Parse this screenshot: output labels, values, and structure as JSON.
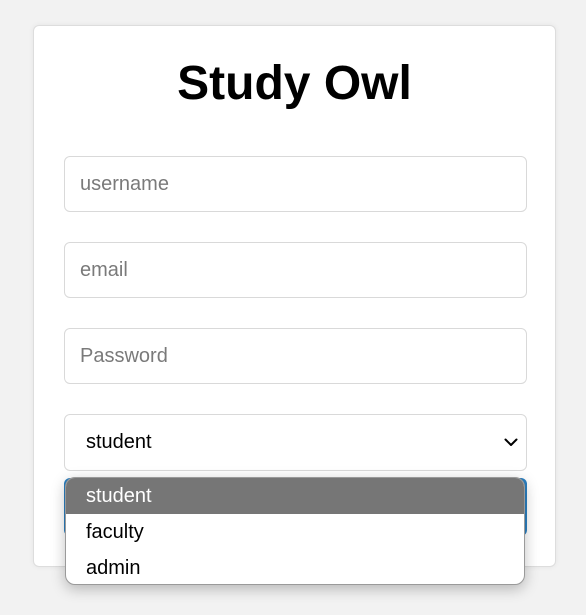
{
  "app": {
    "title": "Study Owl"
  },
  "form": {
    "username": {
      "value": "",
      "placeholder": "username"
    },
    "email": {
      "value": "",
      "placeholder": "email"
    },
    "password": {
      "value": "",
      "placeholder": "Password"
    },
    "role": {
      "selected": "student",
      "options": [
        "student",
        "faculty",
        "admin"
      ],
      "highlighted_index": 0
    },
    "submit_label": ""
  },
  "colors": {
    "accent": "#2b7fc0",
    "highlight": "#767676",
    "border": "#d9d9d9"
  },
  "icons": {
    "select_arrow": "chevron-down-icon"
  }
}
